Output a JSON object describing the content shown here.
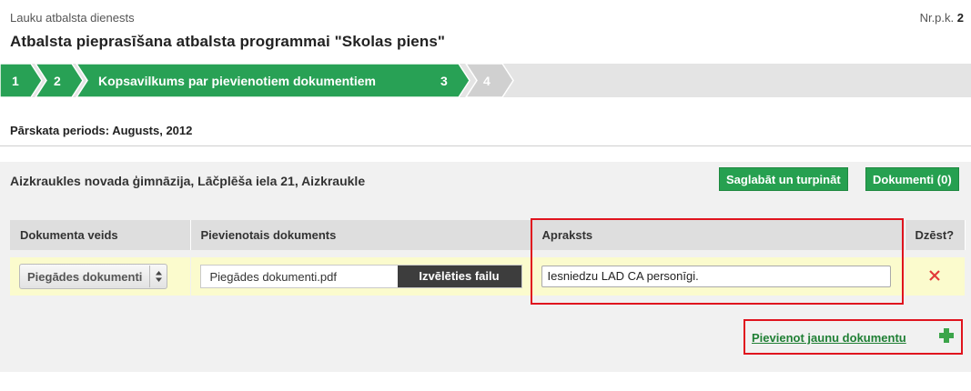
{
  "header": {
    "agency": "Lauku atbalsta dienests",
    "nrpk_label": "Nr.p.k.",
    "nrpk_value": "2",
    "title": "Atbalsta pieprasīšana atbalsta programmai \"Skolas piens\""
  },
  "stepper": {
    "steps": [
      {
        "label": "1"
      },
      {
        "label": "2"
      },
      {
        "label": "Kopsavilkums par pievienotiem dokumentiem"
      },
      {
        "label": "3"
      },
      {
        "label": "4"
      }
    ],
    "active_color": "#28a155",
    "inactive_color": "#d0d0d0"
  },
  "period": "Pārskata periods: Augusts, 2012",
  "panel": {
    "school": "Aizkraukles novada ģimnāzija, Lāčplēša iela 21, Aizkraukle",
    "save_button": "Saglabāt un turpināt",
    "docs_button": "Dokumenti (0)",
    "table": {
      "headers": [
        "Dokumenta veids",
        "Pievienotais dokuments",
        "Apraksts",
        "Dzēst?"
      ],
      "row": {
        "doc_type": "Piegādes dokumenti",
        "file_name": "Piegādes dokumenti.pdf",
        "choose_file": "Izvēlēties failu",
        "description": "Iesniedzu LAD CA personīgi.",
        "delete_icon": "close-icon"
      }
    },
    "add_link": "Pievienot jaunu dokumentu",
    "add_icon": "plus-icon"
  },
  "colors": {
    "accent": "#26a050",
    "highlight_border": "#e0141e",
    "row_bg": "#fbfbcd"
  }
}
